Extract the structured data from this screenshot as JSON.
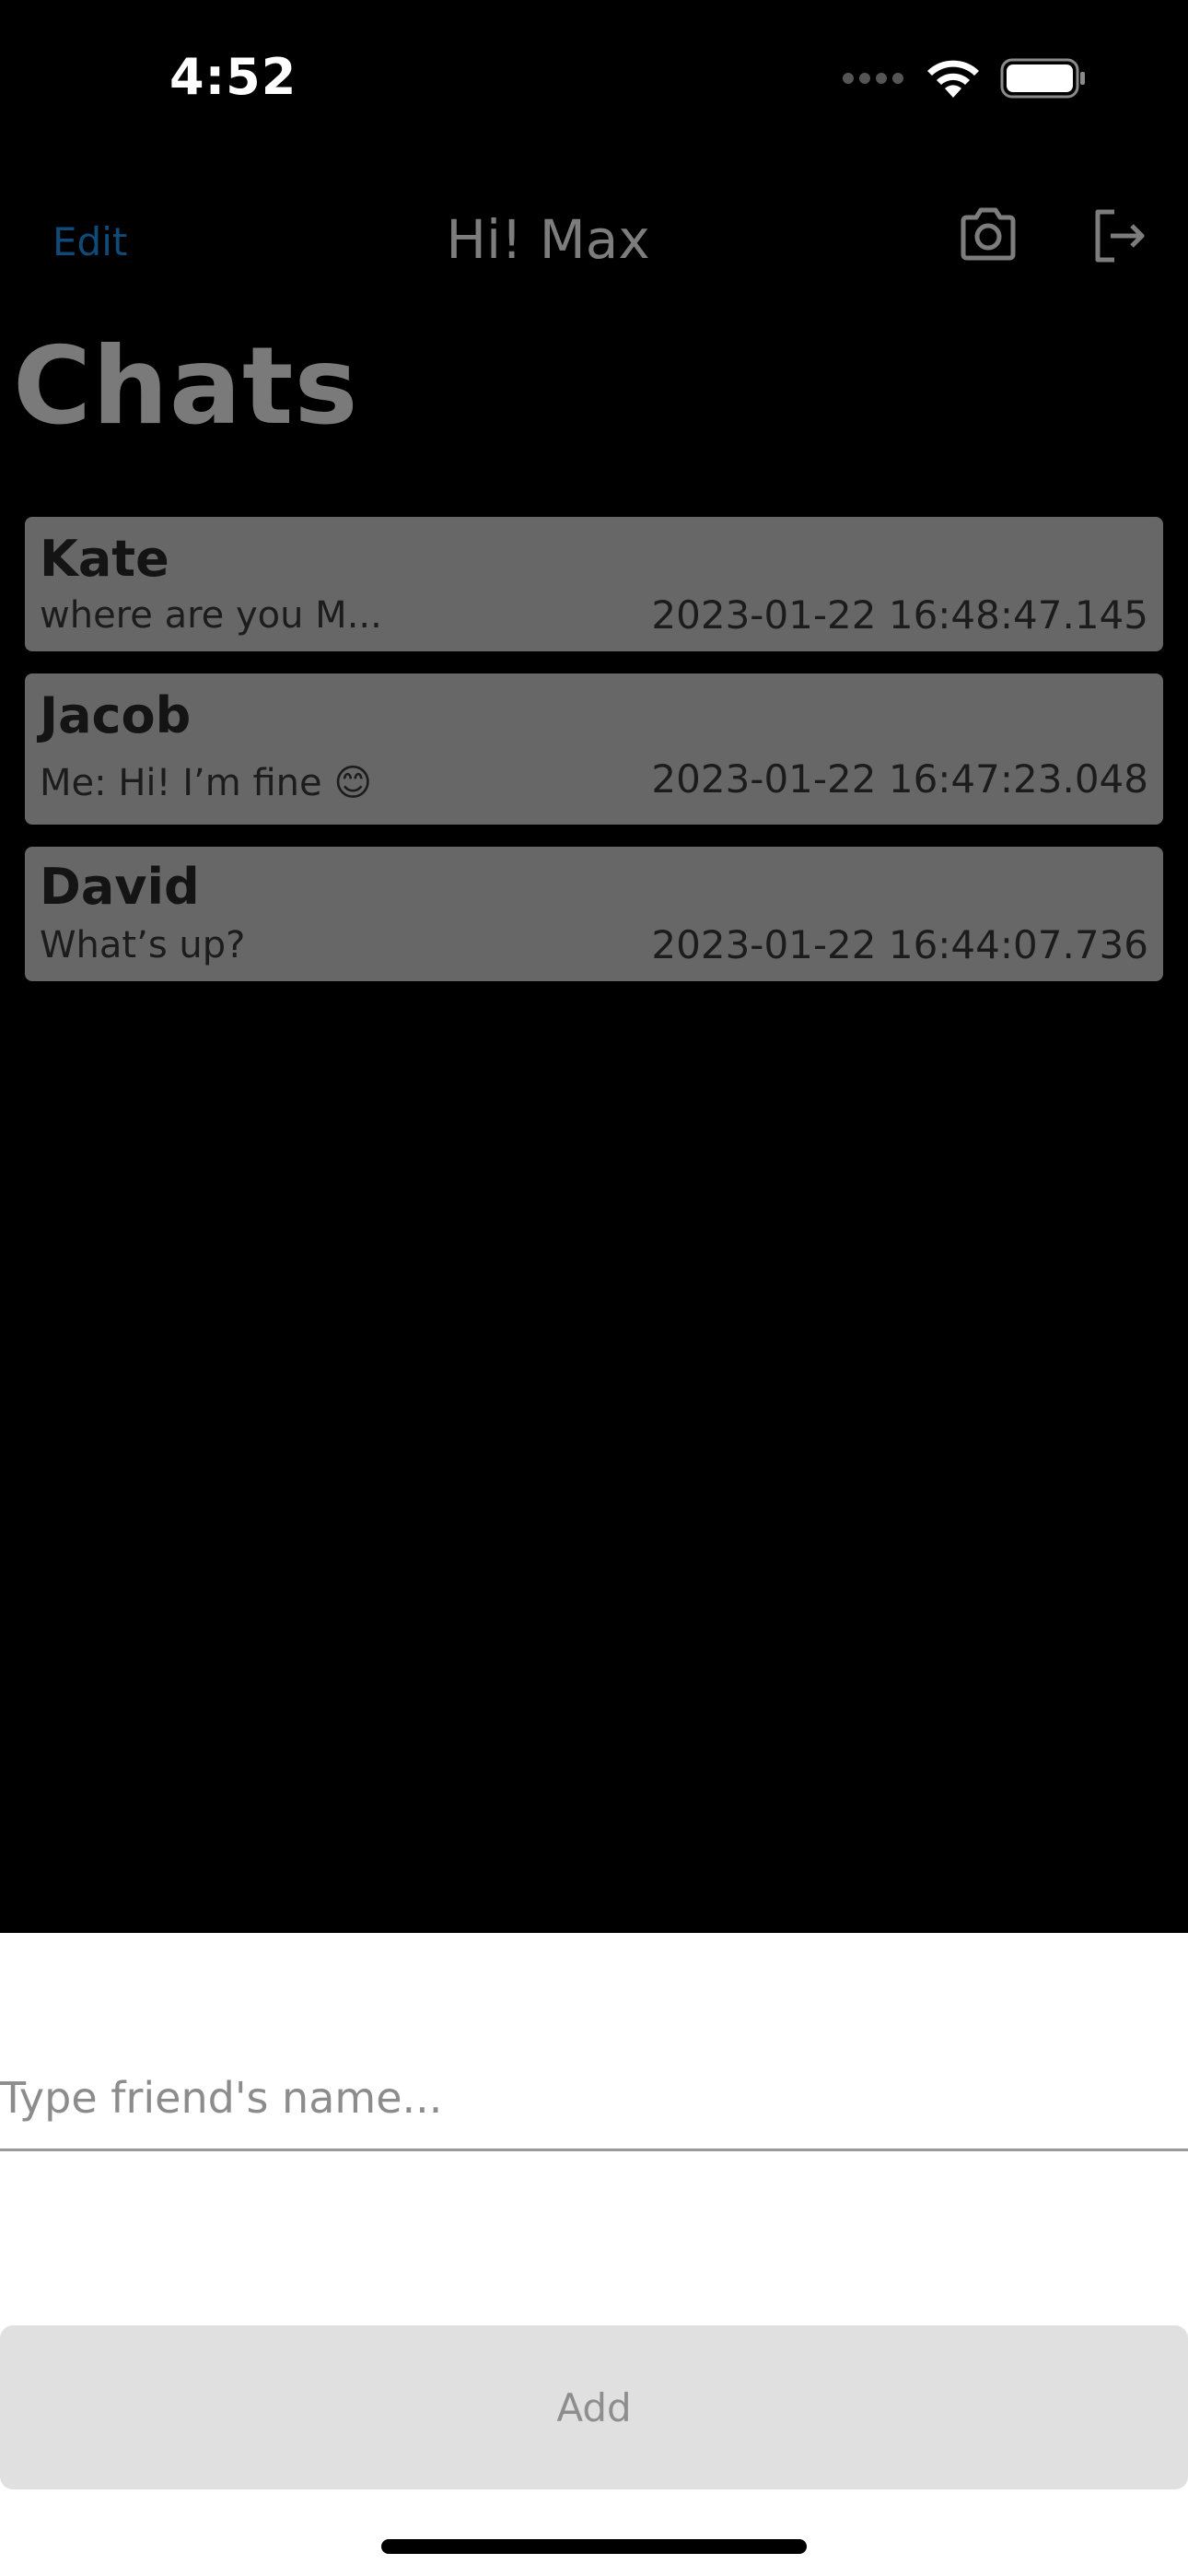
{
  "status_bar": {
    "time": "4:52",
    "icons": [
      "cellular-dots-icon",
      "wifi-icon",
      "battery-icon"
    ]
  },
  "nav": {
    "edit_label": "Edit",
    "title": "Hi! Max",
    "camera_icon": "camera-icon",
    "logout_icon": "logout-icon"
  },
  "large_title": "Chats",
  "chats": [
    {
      "name": "Kate",
      "preview": "where are you M...",
      "time": "2023-01-22 16:48:47.145"
    },
    {
      "name": "Jacob",
      "preview": "Me: Hi! I’m fine 😊",
      "time": "2023-01-22 16:47:23.048"
    },
    {
      "name": "David",
      "preview": "What’s up?",
      "time": "2023-01-22 16:44:07.736"
    }
  ],
  "add_friend": {
    "placeholder": "Type friend's name...",
    "value": "",
    "button_label": "Add"
  },
  "colors": {
    "background": "#000000",
    "row_background": "#676767",
    "edit_accent": "#0f4a78",
    "sheet_background": "#ffffff",
    "button_background": "#e0e0e0"
  }
}
